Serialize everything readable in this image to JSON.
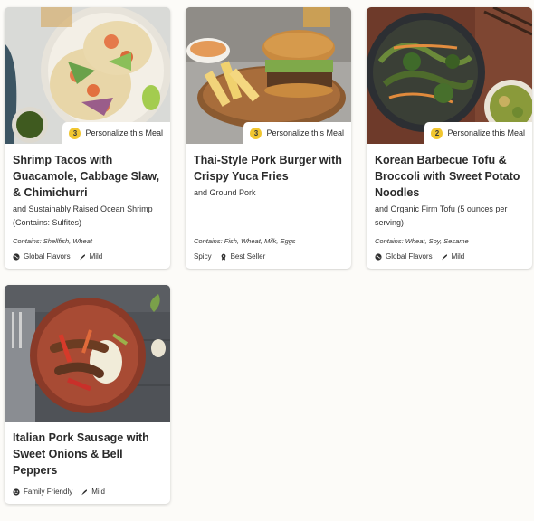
{
  "cards": [
    {
      "title": "Shrimp Tacos with Guacamole, Cabbage Slaw, & Chimichurri",
      "subtitle": "and Sustainably Raised Ocean Shrimp (Contains: Sulfites)",
      "contains": "Contains: Shellfish, Wheat",
      "personalize_count": "3",
      "personalize_label": "Personalize this Meal",
      "tags": [
        {
          "label": "Global Flavors",
          "icon": "globe-icon"
        },
        {
          "label": "Mild",
          "icon": "chili-pepper-icon"
        }
      ]
    },
    {
      "title": "Thai-Style Pork Burger with Crispy Yuca Fries",
      "subtitle": "and Ground Pork",
      "contains": "Contains: Fish, Wheat, Milk, Eggs",
      "personalize_count": "3",
      "personalize_label": "Personalize this Meal",
      "tags": [
        {
          "label": "Spicy",
          "icon": ""
        },
        {
          "label": "Best Seller",
          "icon": "award-icon"
        }
      ]
    },
    {
      "title": "Korean Barbecue Tofu & Broccoli with Sweet Potato Noodles",
      "subtitle": "and Organic Firm Tofu (5 ounces per serving)",
      "contains": "Contains: Wheat, Soy, Sesame",
      "personalize_count": "2",
      "personalize_label": "Personalize this Meal",
      "tags": [
        {
          "label": "Global Flavors",
          "icon": "globe-icon"
        },
        {
          "label": "Mild",
          "icon": "chili-pepper-icon"
        }
      ]
    },
    {
      "title": "Italian Pork Sausage with Sweet Onions & Bell Peppers",
      "subtitle": "",
      "contains": "",
      "personalize_count": "",
      "personalize_label": "",
      "tags": [
        {
          "label": "Family Friendly",
          "icon": "smiley-icon"
        },
        {
          "label": "Mild",
          "icon": "chili-pepper-icon"
        }
      ]
    }
  ],
  "colors": {
    "badge": "#f1c62f",
    "page_background": "#fcfbf8"
  }
}
